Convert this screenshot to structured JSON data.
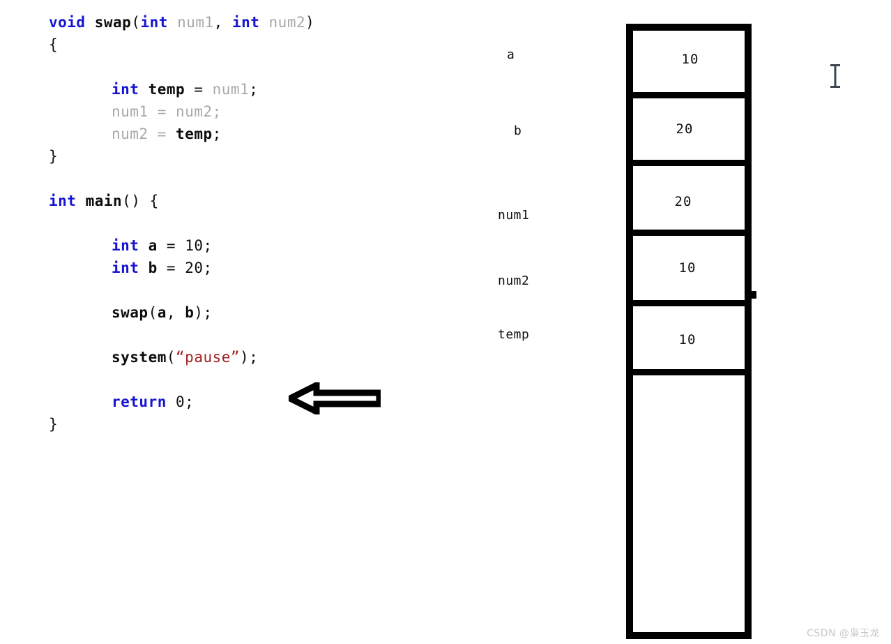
{
  "code": {
    "language": "c",
    "lines": [
      {
        "id": "fn-swap-signature",
        "indent": 0,
        "tokens": [
          {
            "t": "void",
            "c": "kw"
          },
          {
            "t": " ",
            "c": "punct"
          },
          {
            "t": "swap",
            "c": "ident"
          },
          {
            "t": "(",
            "c": "punct"
          },
          {
            "t": "int",
            "c": "kw"
          },
          {
            "t": " ",
            "c": "punct"
          },
          {
            "t": "num1",
            "c": "param"
          },
          {
            "t": ", ",
            "c": "punct"
          },
          {
            "t": "int",
            "c": "kw"
          },
          {
            "t": " ",
            "c": "punct"
          },
          {
            "t": "num2",
            "c": "param"
          },
          {
            "t": ")",
            "c": "punct"
          }
        ]
      },
      {
        "id": "swap-open-brace",
        "indent": 0,
        "tokens": [
          {
            "t": "{",
            "c": "punct"
          }
        ]
      },
      {
        "id": "blank-1",
        "indent": 0,
        "tokens": []
      },
      {
        "id": "stmt-int-temp",
        "indent": 1,
        "tokens": [
          {
            "t": "int",
            "c": "kw"
          },
          {
            "t": " ",
            "c": "punct"
          },
          {
            "t": "temp",
            "c": "ident"
          },
          {
            "t": " ",
            "c": "punct"
          },
          {
            "t": "=",
            "c": "punct"
          },
          {
            "t": " ",
            "c": "punct"
          },
          {
            "t": "num1",
            "c": "param"
          },
          {
            "t": ";",
            "c": "punct"
          }
        ]
      },
      {
        "id": "stmt-num1-assign",
        "indent": 1,
        "tokens": [
          {
            "t": "num1",
            "c": "param"
          },
          {
            "t": " ",
            "c": "punct"
          },
          {
            "t": "=",
            "c": "param"
          },
          {
            "t": " ",
            "c": "punct"
          },
          {
            "t": "num2",
            "c": "param"
          },
          {
            "t": ";",
            "c": "param"
          }
        ]
      },
      {
        "id": "stmt-num2-assign",
        "indent": 1,
        "tokens": [
          {
            "t": "num2",
            "c": "param"
          },
          {
            "t": " ",
            "c": "punct"
          },
          {
            "t": "=",
            "c": "param"
          },
          {
            "t": " ",
            "c": "punct"
          },
          {
            "t": "temp",
            "c": "ident"
          },
          {
            "t": ";",
            "c": "punct"
          }
        ]
      },
      {
        "id": "swap-close-brace",
        "indent": 0,
        "tokens": [
          {
            "t": "}",
            "c": "punct"
          }
        ]
      },
      {
        "id": "blank-2",
        "indent": 0,
        "tokens": []
      },
      {
        "id": "fn-main-signature",
        "indent": 0,
        "tokens": [
          {
            "t": "int",
            "c": "kw"
          },
          {
            "t": " ",
            "c": "punct"
          },
          {
            "t": "main",
            "c": "ident"
          },
          {
            "t": "() {",
            "c": "punct"
          }
        ]
      },
      {
        "id": "blank-3",
        "indent": 0,
        "tokens": []
      },
      {
        "id": "stmt-int-a",
        "indent": 1,
        "tokens": [
          {
            "t": "int",
            "c": "kw"
          },
          {
            "t": " ",
            "c": "punct"
          },
          {
            "t": "a",
            "c": "ident"
          },
          {
            "t": " ",
            "c": "punct"
          },
          {
            "t": "=",
            "c": "punct"
          },
          {
            "t": " ",
            "c": "punct"
          },
          {
            "t": "10",
            "c": "num"
          },
          {
            "t": ";",
            "c": "punct"
          }
        ]
      },
      {
        "id": "stmt-int-b",
        "indent": 1,
        "tokens": [
          {
            "t": "int",
            "c": "kw"
          },
          {
            "t": " ",
            "c": "punct"
          },
          {
            "t": "b",
            "c": "ident"
          },
          {
            "t": " ",
            "c": "punct"
          },
          {
            "t": "=",
            "c": "punct"
          },
          {
            "t": " ",
            "c": "punct"
          },
          {
            "t": "20",
            "c": "num"
          },
          {
            "t": ";",
            "c": "punct"
          }
        ]
      },
      {
        "id": "blank-4",
        "indent": 0,
        "tokens": []
      },
      {
        "id": "stmt-swap-call",
        "indent": 1,
        "tokens": [
          {
            "t": "swap",
            "c": "ident"
          },
          {
            "t": "(",
            "c": "punct"
          },
          {
            "t": "a",
            "c": "ident"
          },
          {
            "t": ", ",
            "c": "punct"
          },
          {
            "t": "b",
            "c": "ident"
          },
          {
            "t": ");",
            "c": "punct"
          }
        ]
      },
      {
        "id": "blank-5",
        "indent": 0,
        "tokens": []
      },
      {
        "id": "stmt-system-pause",
        "indent": 1,
        "tokens": [
          {
            "t": "system",
            "c": "ident"
          },
          {
            "t": "(",
            "c": "punct"
          },
          {
            "t": "“",
            "c": "str"
          },
          {
            "t": "pause",
            "c": "str"
          },
          {
            "t": "”",
            "c": "str"
          },
          {
            "t": ");",
            "c": "punct"
          }
        ]
      },
      {
        "id": "blank-6",
        "indent": 0,
        "tokens": []
      },
      {
        "id": "stmt-return",
        "indent": 1,
        "tokens": [
          {
            "t": "return",
            "c": "kw"
          },
          {
            "t": " ",
            "c": "punct"
          },
          {
            "t": "0",
            "c": "num"
          },
          {
            "t": ";",
            "c": "punct"
          }
        ]
      },
      {
        "id": "main-close-brace",
        "indent": 0,
        "tokens": [
          {
            "t": "}",
            "c": "punct"
          }
        ]
      }
    ]
  },
  "memory": {
    "title": "stack-memory-column",
    "cells": [
      {
        "name": "a",
        "value": "10"
      },
      {
        "name": "b",
        "value": "20"
      },
      {
        "name": "num1",
        "value": "20"
      },
      {
        "name": "num2",
        "value": "10"
      },
      {
        "name": "temp",
        "value": "10"
      },
      {
        "name": "",
        "value": ""
      }
    ],
    "labels": {
      "a": "a",
      "b": "b",
      "num1": "num1",
      "num2": "num2",
      "temp": "temp"
    }
  },
  "annotations": {
    "pointer_arrow": "left-pointing-block-arrow",
    "text_cursor": "I-beam"
  },
  "watermark": {
    "text": "CSDN @枭玉龙"
  },
  "colors": {
    "keyword": "#1414d2",
    "identifier": "#0d0d0d",
    "parameter": "#a8a8a8",
    "string": "#a02020",
    "box_border": "#000000",
    "background": "#ffffff",
    "watermark": "#c6c6c6"
  }
}
